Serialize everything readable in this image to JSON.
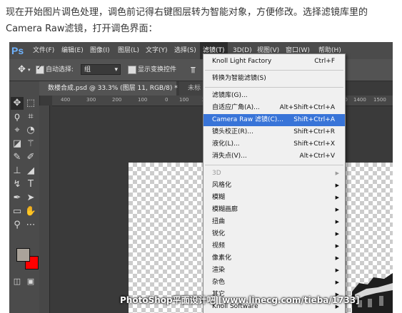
{
  "intro": {
    "line1": "现在开始图片调色处理，调色前记得右键图层转为智能对象，方便修改。选择滤镜库里的",
    "line2": "Camera Raw滤镜，打开调色界面："
  },
  "app": {
    "logo": "Ps",
    "menu": [
      "文件(F)",
      "编辑(E)",
      "图像(I)",
      "图层(L)",
      "文字(Y)",
      "选择(S)",
      "滤镜(T)",
      "3D(D)",
      "视图(V)",
      "窗口(W)",
      "帮助(H)"
    ],
    "active_menu": "滤镜(T)"
  },
  "options_bar": {
    "auto_select_label": "自动选择:",
    "auto_select_value": "组",
    "show_transform_label": "显示变换控件",
    "move_icon": "move-icon"
  },
  "tabs": [
    {
      "label": "数楼合成.psd @ 33.3% (图层 11, RGB/8) *",
      "close": "×"
    },
    {
      "label": "未标",
      "close": ""
    }
  ],
  "ruler_marks": [
    "400",
    "300",
    "200",
    "100",
    "0",
    "100",
    "200",
    "300",
    "1300",
    "1400",
    "1500"
  ],
  "filter_menu": {
    "items": [
      {
        "label": "Knoll Light Factory",
        "shortcut": "Ctrl+F",
        "state": "normal"
      },
      {
        "sep": true
      },
      {
        "label": "转换为智能滤镜(S)",
        "shortcut": "",
        "state": "normal"
      },
      {
        "sep": true
      },
      {
        "label": "滤镜库(G)...",
        "shortcut": "",
        "state": "normal"
      },
      {
        "label": "自适应广角(A)...",
        "shortcut": "Alt+Shift+Ctrl+A",
        "state": "normal"
      },
      {
        "label": "Camera Raw 滤镜(C)...",
        "shortcut": "Shift+Ctrl+A",
        "state": "highlight"
      },
      {
        "label": "镜头校正(R)...",
        "shortcut": "Shift+Ctrl+R",
        "state": "normal"
      },
      {
        "label": "液化(L)...",
        "shortcut": "Shift+Ctrl+X",
        "state": "normal"
      },
      {
        "label": "消失点(V)...",
        "shortcut": "Alt+Ctrl+V",
        "state": "normal"
      },
      {
        "sep": true
      },
      {
        "label": "3D",
        "submenu": true,
        "state": "disabled"
      },
      {
        "label": "风格化",
        "submenu": true,
        "state": "normal"
      },
      {
        "label": "模糊",
        "submenu": true,
        "state": "normal"
      },
      {
        "label": "模糊画廊",
        "submenu": true,
        "state": "normal"
      },
      {
        "label": "扭曲",
        "submenu": true,
        "state": "normal"
      },
      {
        "label": "锐化",
        "submenu": true,
        "state": "normal"
      },
      {
        "label": "视频",
        "submenu": true,
        "state": "normal"
      },
      {
        "label": "像素化",
        "submenu": true,
        "state": "normal"
      },
      {
        "label": "渲染",
        "submenu": true,
        "state": "normal"
      },
      {
        "label": "杂色",
        "submenu": true,
        "state": "normal"
      },
      {
        "label": "其它",
        "submenu": true,
        "state": "normal"
      },
      {
        "label": "Knoll Software",
        "submenu": true,
        "state": "normal"
      }
    ]
  },
  "toolbar": {
    "tools": [
      "move-icon",
      "marquee-icon",
      "lasso-icon",
      "crop-icon",
      "eyedropper-icon",
      "quick-select-icon",
      "healing-icon",
      "brush-icon",
      "stamp-icon",
      "eraser-icon",
      "history-brush-icon",
      "text-icon",
      "pen-icon",
      "path-select-icon",
      "rectangle-icon",
      "hand-icon",
      "zoom-icon",
      "more-icon"
    ],
    "foreground_color": "#aaa39a",
    "background_color": "#ff0000"
  },
  "watermark": "PhotoShop平面设计吧  [www.linecg.com/tieba/1733]",
  "colors": {
    "menubar": "#4b4b4b",
    "highlight": "#3874d8",
    "ps_blue": "#6fb3ff"
  }
}
